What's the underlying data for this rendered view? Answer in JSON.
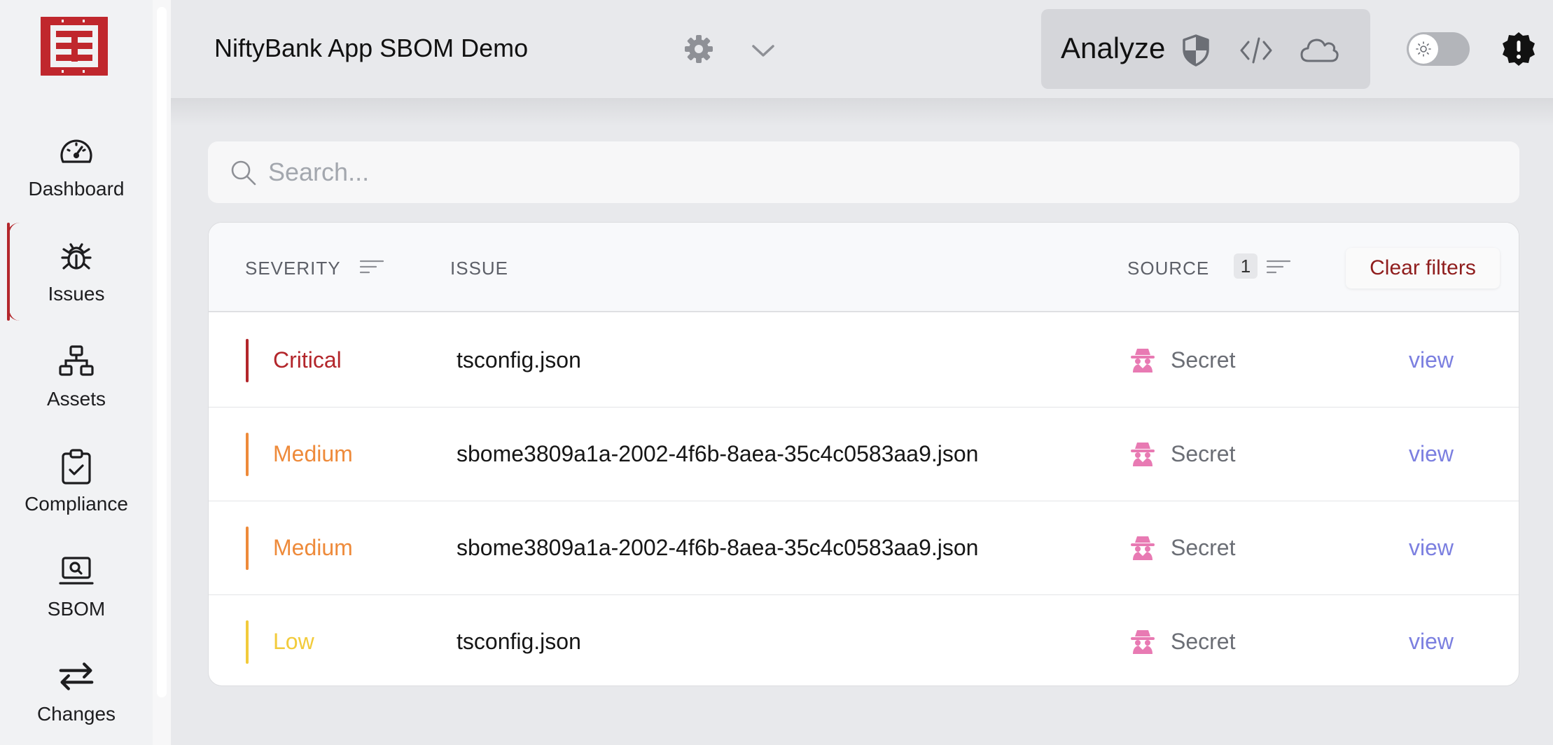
{
  "sidebar": {
    "items": [
      {
        "label": "Dashboard",
        "icon": "gauge-icon"
      },
      {
        "label": "Issues",
        "icon": "bug-icon"
      },
      {
        "label": "Assets",
        "icon": "network-icon"
      },
      {
        "label": "Compliance",
        "icon": "clipboard-check-icon"
      },
      {
        "label": "SBOM",
        "icon": "laptop-search-icon"
      },
      {
        "label": "Changes",
        "icon": "arrows-exchange-icon"
      }
    ],
    "active": "Issues"
  },
  "header": {
    "project_title": "NiftyBank App SBOM Demo",
    "analyze_label": "Analyze"
  },
  "search": {
    "placeholder": "Search..."
  },
  "table": {
    "columns": {
      "severity": "SEVERITY",
      "issue": "ISSUE",
      "source": "SOURCE"
    },
    "source_filter_count": "1",
    "clear_filters": "Clear filters",
    "rows": [
      {
        "severity": "Critical",
        "issue": "tsconfig.json",
        "source": "Secret",
        "action": "view"
      },
      {
        "severity": "Medium",
        "issue": "sbome3809a1a-2002-4f6b-8aea-35c4c0583aa9.json",
        "source": "Secret",
        "action": "view"
      },
      {
        "severity": "Medium",
        "issue": "sbome3809a1a-2002-4f6b-8aea-35c4c0583aa9.json",
        "source": "Secret",
        "action": "view"
      },
      {
        "severity": "Low",
        "issue": "tsconfig.json",
        "source": "Secret",
        "action": "view"
      }
    ]
  },
  "colors": {
    "brand": "#b3262b",
    "critical": "#b3262b",
    "medium": "#ee8a3a",
    "low": "#f2cb3b",
    "link": "#7b7fe0",
    "secret_icon": "#e87ab3",
    "clear_filters": "#8f1d1d"
  }
}
